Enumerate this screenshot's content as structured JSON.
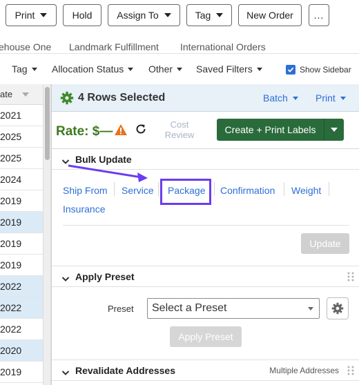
{
  "toolbar": {
    "print": "Print",
    "hold": "Hold",
    "assign_to": "Assign To",
    "tag": "Tag",
    "new_order": "New Order",
    "more": "..."
  },
  "stores": [
    "ehouse One",
    "Landmark Fulfillment",
    "International Orders"
  ],
  "filters": {
    "tag": "Tag",
    "allocation_status": "Allocation Status",
    "other": "Other",
    "saved_filters": "Saved Filters",
    "show_sidebar": "Show Sidebar",
    "show_sidebar_checked": true
  },
  "grid": {
    "header": "ate",
    "rows": [
      {
        "value": "2021",
        "selected": false
      },
      {
        "value": "2025",
        "selected": false
      },
      {
        "value": "2025",
        "selected": false
      },
      {
        "value": "2024",
        "selected": false
      },
      {
        "value": "2019",
        "selected": false
      },
      {
        "value": "2019",
        "selected": true
      },
      {
        "value": "2019",
        "selected": false
      },
      {
        "value": "2019",
        "selected": false
      },
      {
        "value": "2022",
        "selected": true
      },
      {
        "value": "2022",
        "selected": true
      },
      {
        "value": "2022",
        "selected": false
      },
      {
        "value": "2020",
        "selected": true
      },
      {
        "value": "2019",
        "selected": false
      }
    ]
  },
  "panel": {
    "rows_selected": "4 Rows Selected",
    "batch": "Batch",
    "print": "Print",
    "rate": "Rate: $—",
    "cost_review": "Cost Review",
    "create_print_labels": "Create + Print Labels",
    "bulk_update": {
      "title": "Bulk Update",
      "tabs": [
        "Ship From",
        "Service",
        "Package",
        "Confirmation",
        "Weight",
        "Insurance"
      ],
      "highlighted_tab": "Package",
      "update_button": "Update"
    },
    "apply_preset": {
      "title": "Apply Preset",
      "preset_label": "Preset",
      "preset_placeholder": "Select a Preset",
      "apply_button": "Apply Preset"
    },
    "revalidate": {
      "title": "Revalidate Addresses",
      "note": "Multiple Addresses"
    }
  },
  "colors": {
    "accent_blue": "#2c6fd6",
    "rate_green": "#3d7a1f",
    "button_green": "#2a6b3c",
    "highlight_purple": "#6b3cf0",
    "warning_orange": "#e8731c",
    "selected_row": "#dbeaf7"
  }
}
